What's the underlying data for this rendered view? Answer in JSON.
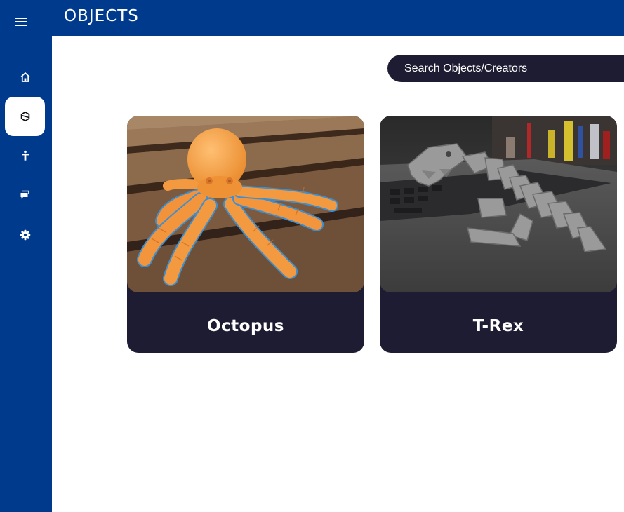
{
  "header": {
    "title": "OBJECTS"
  },
  "sidebar": {
    "menu_icon": "hamburger-menu-icon",
    "items": [
      {
        "icon": "home-icon",
        "active": false
      },
      {
        "icon": "object-icon",
        "active": true
      },
      {
        "icon": "person-icon",
        "active": false
      },
      {
        "icon": "chat-icon",
        "active": false
      },
      {
        "icon": "gear-icon",
        "active": false
      }
    ]
  },
  "search": {
    "placeholder": "Search Objects/Creators",
    "value": ""
  },
  "cards": [
    {
      "label": "Octopus",
      "image": "orange 3D-printed articulated octopus on wooden bench"
    },
    {
      "label": "T-Rex",
      "image": "grey 3D-printed flexi T-Rex on laptop"
    }
  ],
  "colors": {
    "primary": "#003A8C",
    "card": "#1E1C32",
    "background": "#FFFFFF",
    "text_light": "#FFFFFF"
  }
}
